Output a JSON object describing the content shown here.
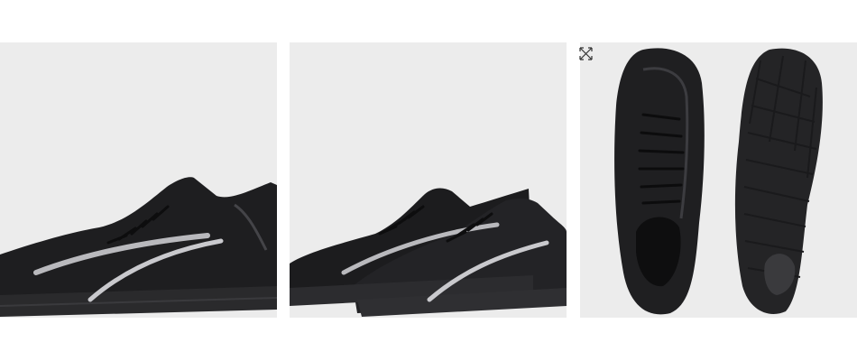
{
  "gallery": {
    "images": [
      {
        "icon": "shoe-side-view-image"
      },
      {
        "icon": "shoe-pair-angled-image"
      },
      {
        "icon": "shoe-top-and-sole-image"
      }
    ],
    "expand_icon": "expand-arrows-icon"
  },
  "colors": {
    "tile_background": "#ececec",
    "shoe_body": "#1e1e20",
    "shoe_accent": "#b9b9bd"
  }
}
